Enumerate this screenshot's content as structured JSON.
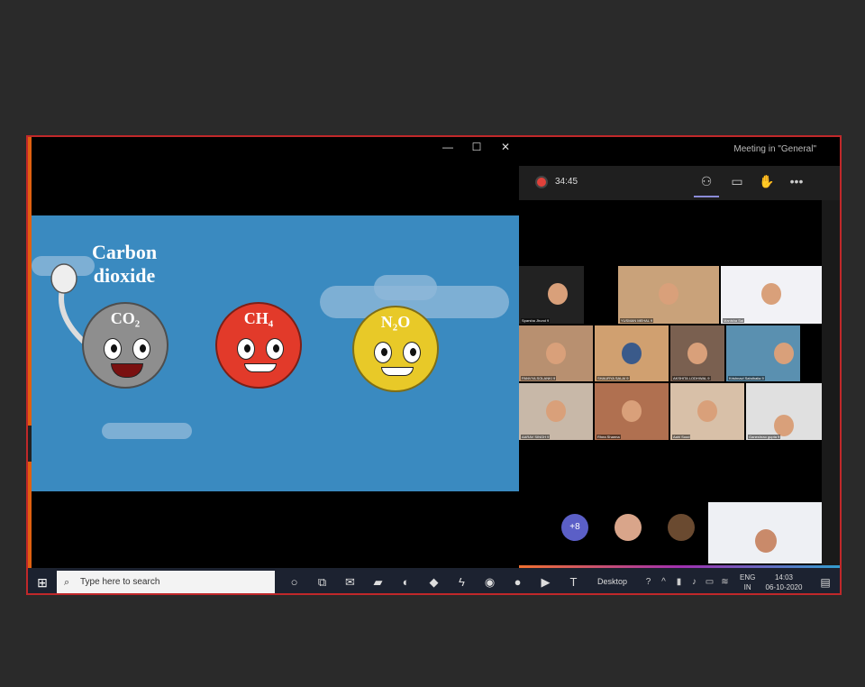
{
  "teams": {
    "meeting_title": "Meeting in \"General\"",
    "timer": "34:45",
    "overflow_count": "+8",
    "participants": [
      "Sparsha Jhund 9",
      "YUSMAN MEHAL 9",
      "Manisha Sai",
      "PANVYA SOLANKI 9",
      "SHAURYA SALAI 9",
      "AKSHITA LODHWAL 9",
      "Krishnavi Sahdhalia 9",
      "AARAV SINGH 9",
      "Rhea Sharma",
      "Aahi Sood",
      "Ganeshrao gupta 9"
    ]
  },
  "slide": {
    "title_line1": "Carbon",
    "title_line2": "dioxide",
    "co2": "CO₂",
    "ch4": "CH₄",
    "n2o": "N₂O",
    "colors": {
      "co2": "#8e8e8e",
      "ch4": "#e23a2a",
      "n2o": "#e8c928",
      "background": "#3a8ac0"
    }
  },
  "taskbar": {
    "search_placeholder": "Type here to search",
    "desktop_label": "Desktop",
    "lang_line1": "ENG",
    "lang_line2": "IN",
    "time": "14:03",
    "date": "06-10-2020"
  }
}
